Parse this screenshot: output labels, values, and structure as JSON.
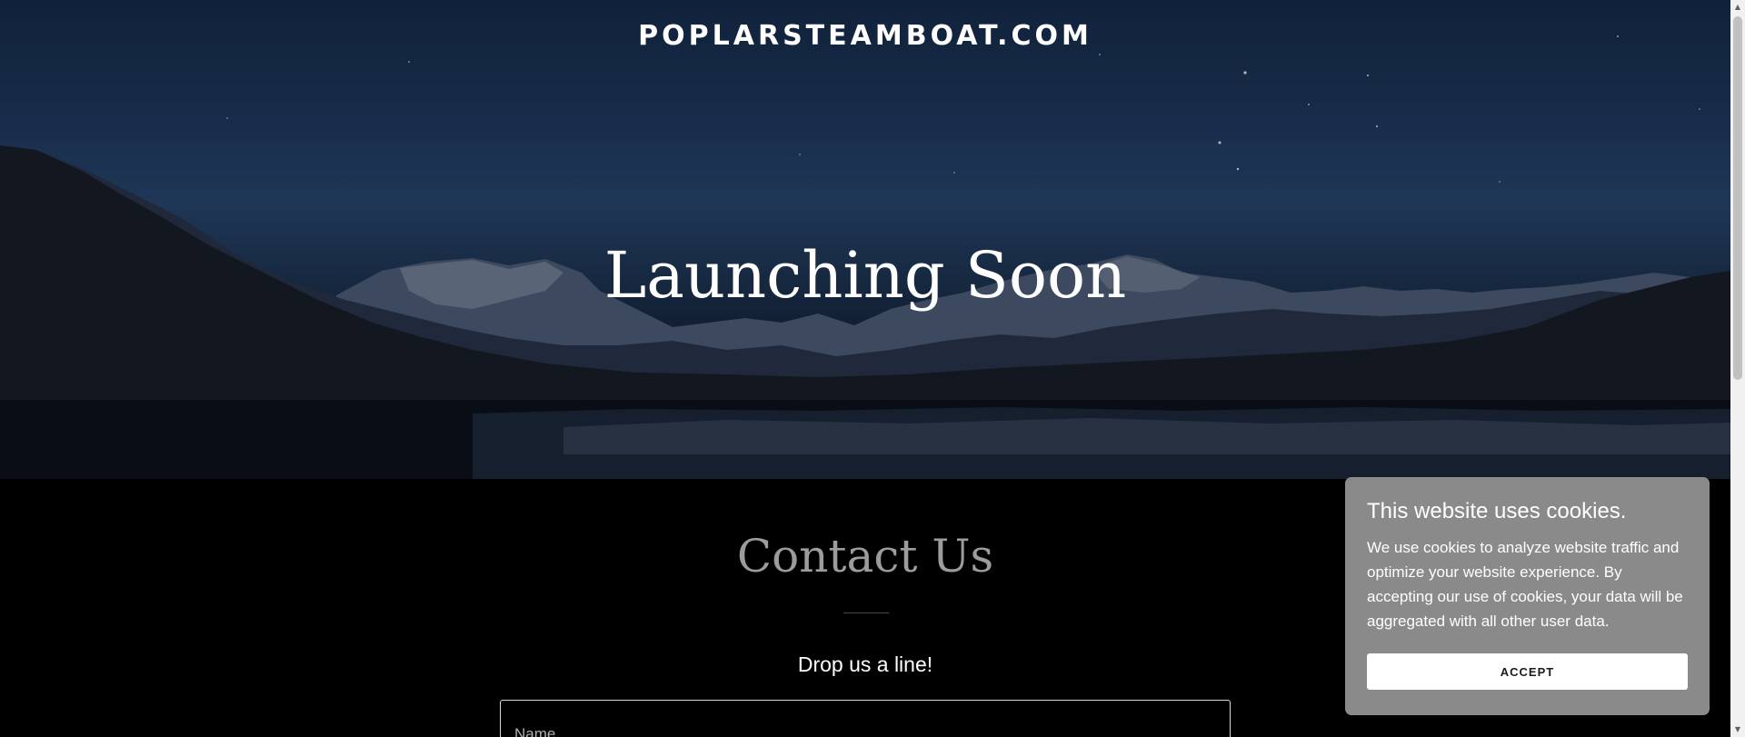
{
  "header": {
    "site_title": "POPLARSTEAMBOAT.COM"
  },
  "hero": {
    "heading": "Launching Soon"
  },
  "contact": {
    "title": "Contact Us",
    "subtitle": "Drop us a line!",
    "name_placeholder": "Name"
  },
  "cookie_banner": {
    "title": "This website uses cookies.",
    "text": "We use cookies to analyze website traffic and optimize your website experience. By accepting our use of cookies, your data will be aggregated with all other user data.",
    "accept_label": "ACCEPT"
  },
  "colors": {
    "page_background": "#000000",
    "contact_title": "#9c9c9c",
    "cookie_background": "#8a8a8a",
    "accept_button": "#ffffff"
  }
}
